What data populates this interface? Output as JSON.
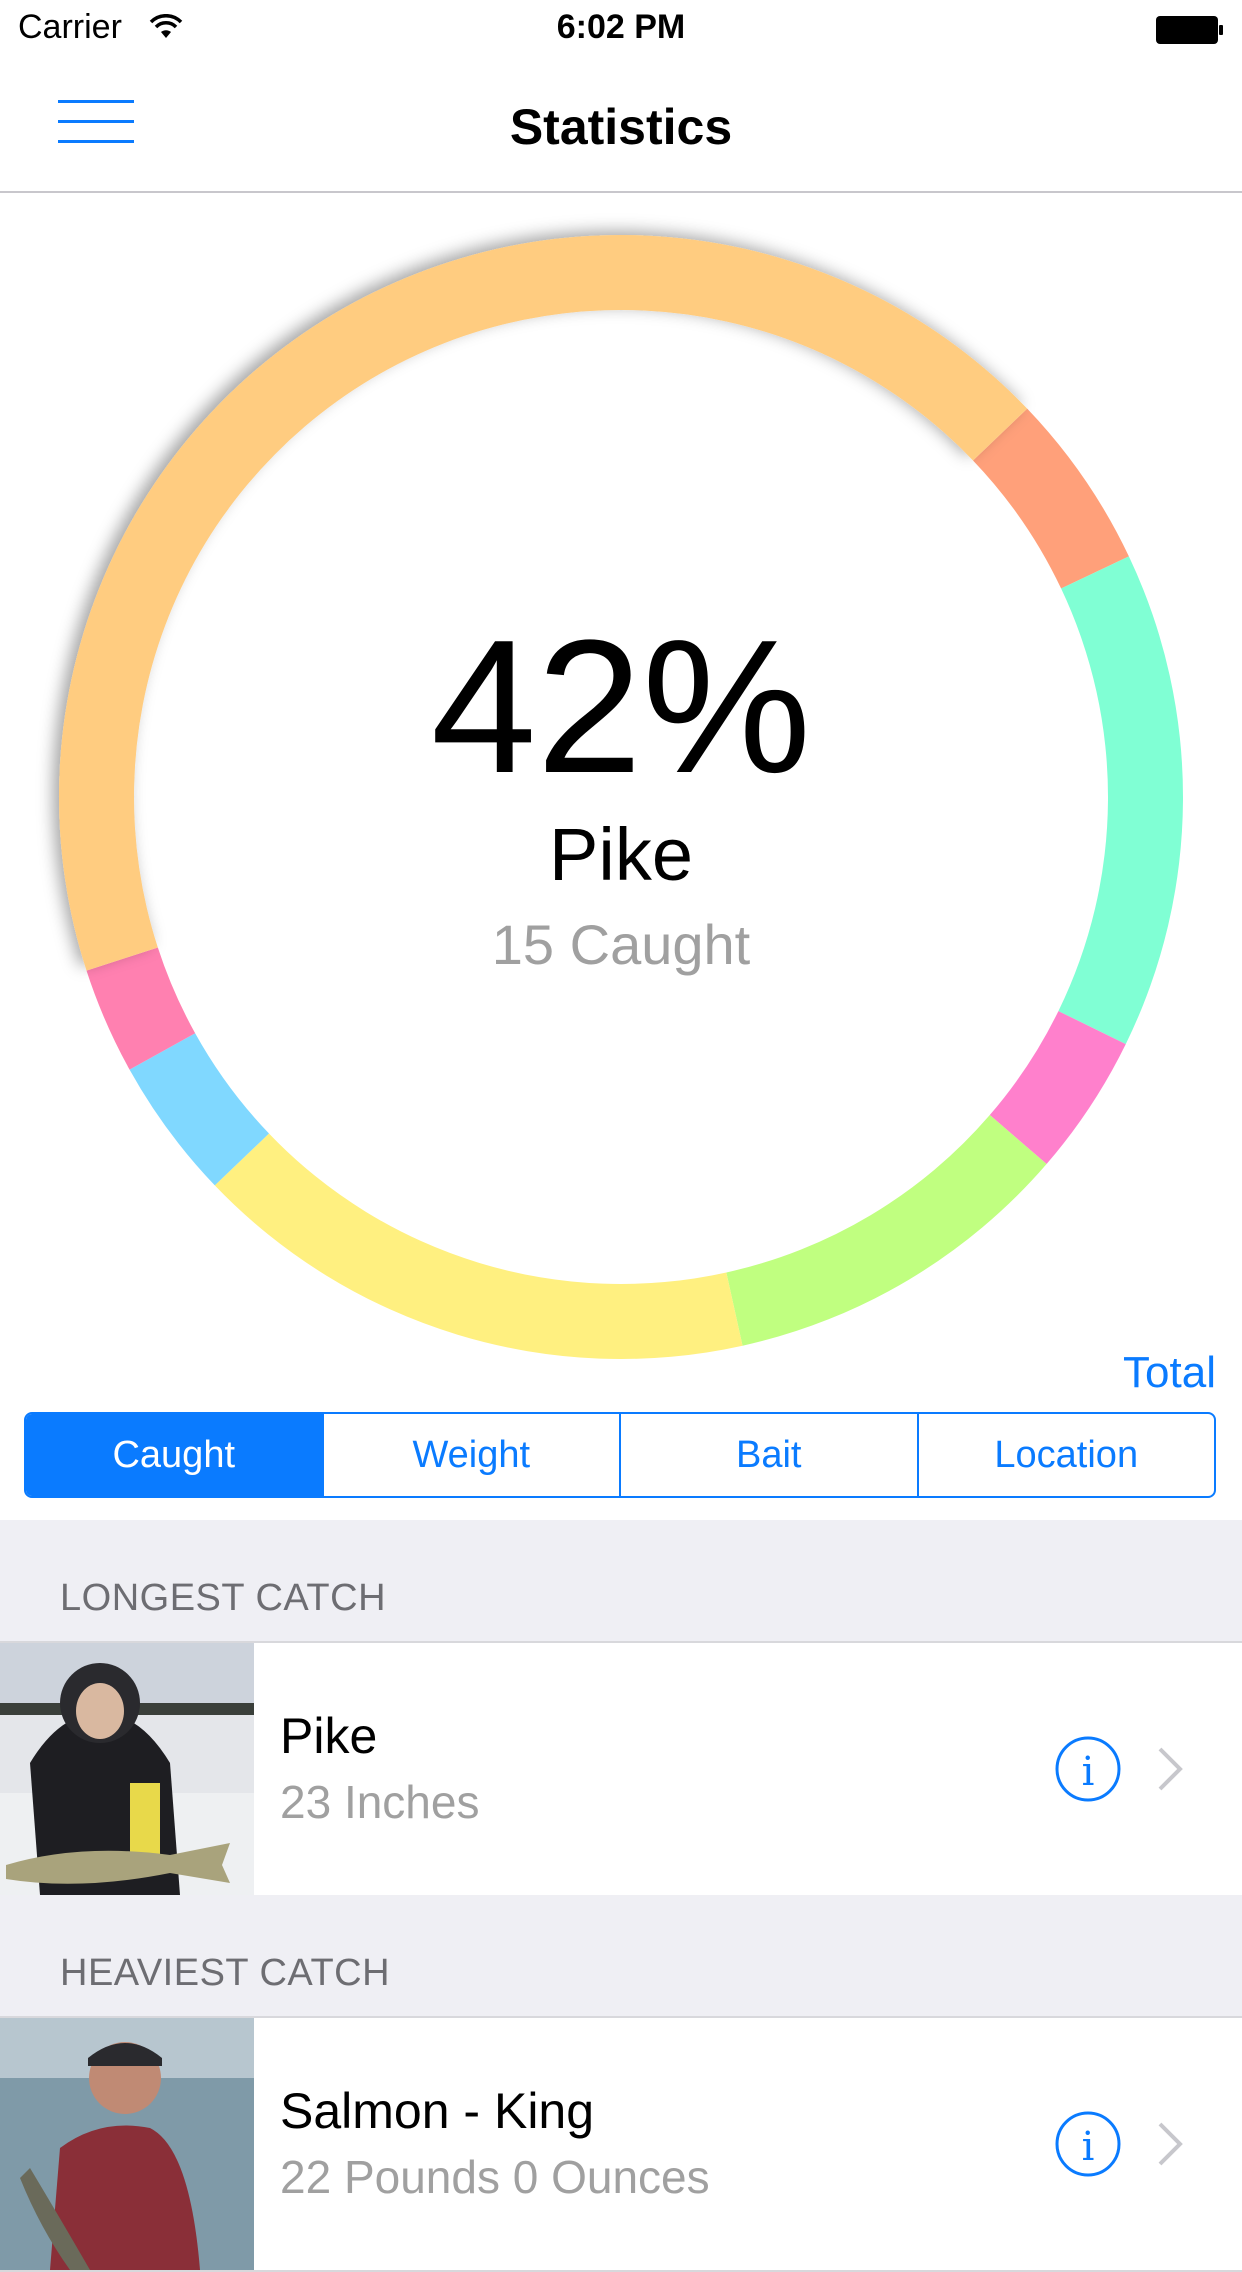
{
  "status_bar": {
    "carrier": "Carrier",
    "time": "6:02 PM"
  },
  "nav": {
    "title": "Statistics",
    "menu_icon": "hamburger-icon"
  },
  "chart_data": {
    "type": "pie",
    "style": "donut",
    "selected": {
      "percent_label": "42%",
      "name": "Pike",
      "sub": "15 Caught"
    },
    "slices": [
      {
        "value": 42,
        "color": "#ffcc80"
      },
      {
        "value": 5,
        "color": "#ffa07a"
      },
      {
        "value": 14,
        "color": "#80ffd4"
      },
      {
        "value": 4,
        "color": "#ff80cc"
      },
      {
        "value": 10,
        "color": "#c0ff80"
      },
      {
        "value": 16,
        "color": "#fff080"
      },
      {
        "value": 4,
        "color": "#80d8ff"
      },
      {
        "value": 3,
        "color": "#ff80b0"
      }
    ]
  },
  "total_label": "Total",
  "segments": [
    {
      "label": "Caught",
      "active": true
    },
    {
      "label": "Weight",
      "active": false
    },
    {
      "label": "Bait",
      "active": false
    },
    {
      "label": "Location",
      "active": false
    }
  ],
  "longest": {
    "header": "LONGEST CATCH",
    "title": "Pike",
    "detail": "23 Inches"
  },
  "heaviest": {
    "header": "HEAVIEST CATCH",
    "title": "Salmon - King",
    "detail": "22 Pounds 0 Ounces"
  },
  "colors": {
    "accent": "#0a7bff",
    "header_bg": "#efeff4"
  }
}
